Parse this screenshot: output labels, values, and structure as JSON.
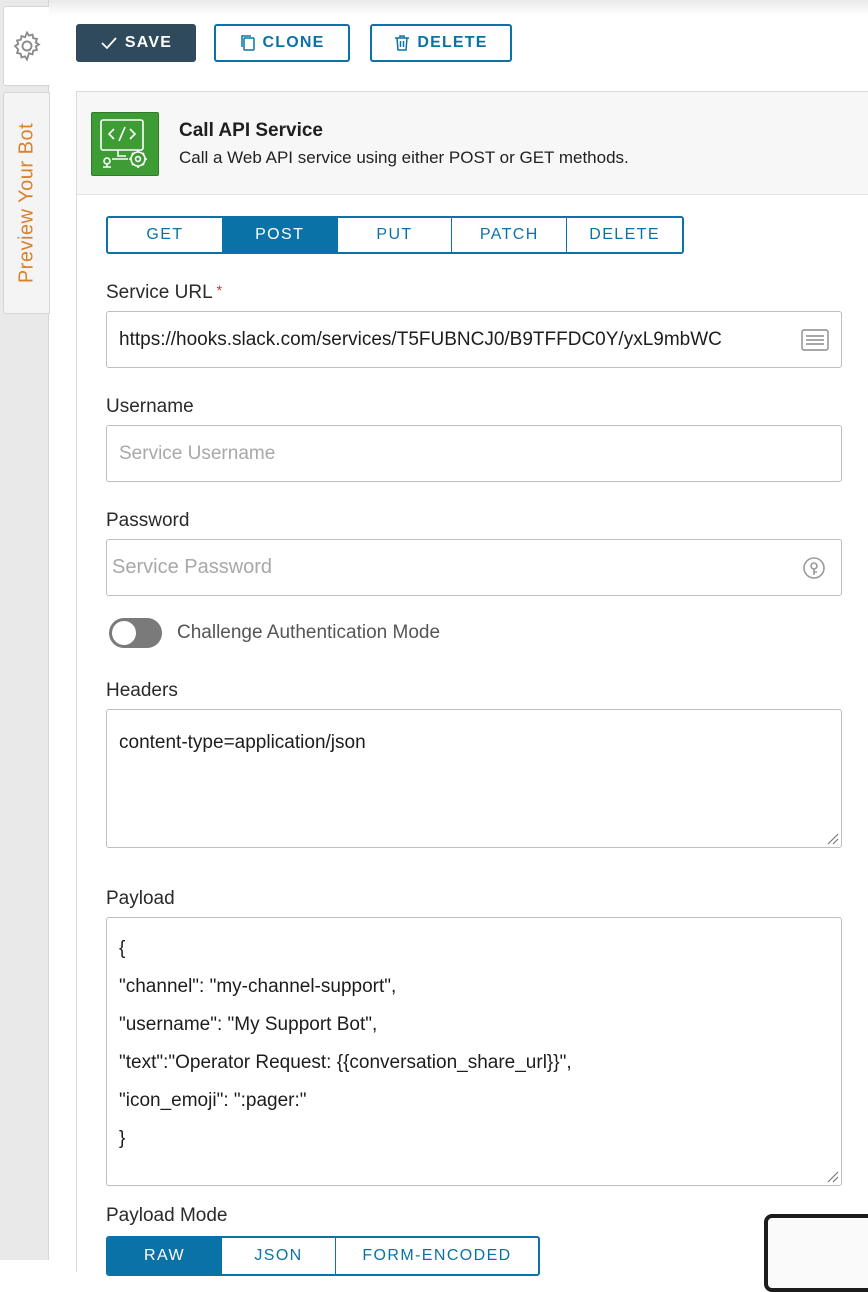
{
  "sidebar": {
    "preview_label": "Preview Your Bot"
  },
  "toolbar": {
    "save_label": "SAVE",
    "clone_label": "CLONE",
    "delete_label": "DELETE"
  },
  "service": {
    "title": "Call API Service",
    "description": "Call a Web API service using either POST or GET methods."
  },
  "methods": {
    "items": [
      "GET",
      "POST",
      "PUT",
      "PATCH",
      "DELETE"
    ],
    "selected": "POST"
  },
  "form": {
    "service_url": {
      "label": "Service URL",
      "required_mark": "*",
      "value": "https://hooks.slack.com/services/T5FUBNCJ0/B9TFFDC0Y/yxL9mbWC"
    },
    "username": {
      "label": "Username",
      "placeholder": "Service Username"
    },
    "password": {
      "label": "Password",
      "placeholder": "Service Password"
    },
    "challenge_auth": {
      "label": "Challenge Authentication Mode",
      "enabled": false
    },
    "headers": {
      "label": "Headers",
      "value": "content-type=application/json"
    },
    "payload": {
      "label": "Payload",
      "lines": [
        "{",
        "\"channel\": \"my-channel-support\",",
        "\"username\": \"My Support Bot\",",
        "\"text\":\"Operator Request: {{conversation_share_url}}\",",
        "\"icon_emoji\": \":pager:\"",
        "}"
      ]
    },
    "payload_mode": {
      "label": "Payload Mode",
      "items": [
        "RAW",
        "JSON",
        "FORM-ENCODED"
      ],
      "selected": "RAW"
    }
  },
  "colors": {
    "accent": "#0b72a8",
    "save_bg": "#2f4a5c",
    "service_icon_bg": "#3e9c35",
    "preview_tab_text": "#d9822b",
    "required": "#d0312d"
  }
}
